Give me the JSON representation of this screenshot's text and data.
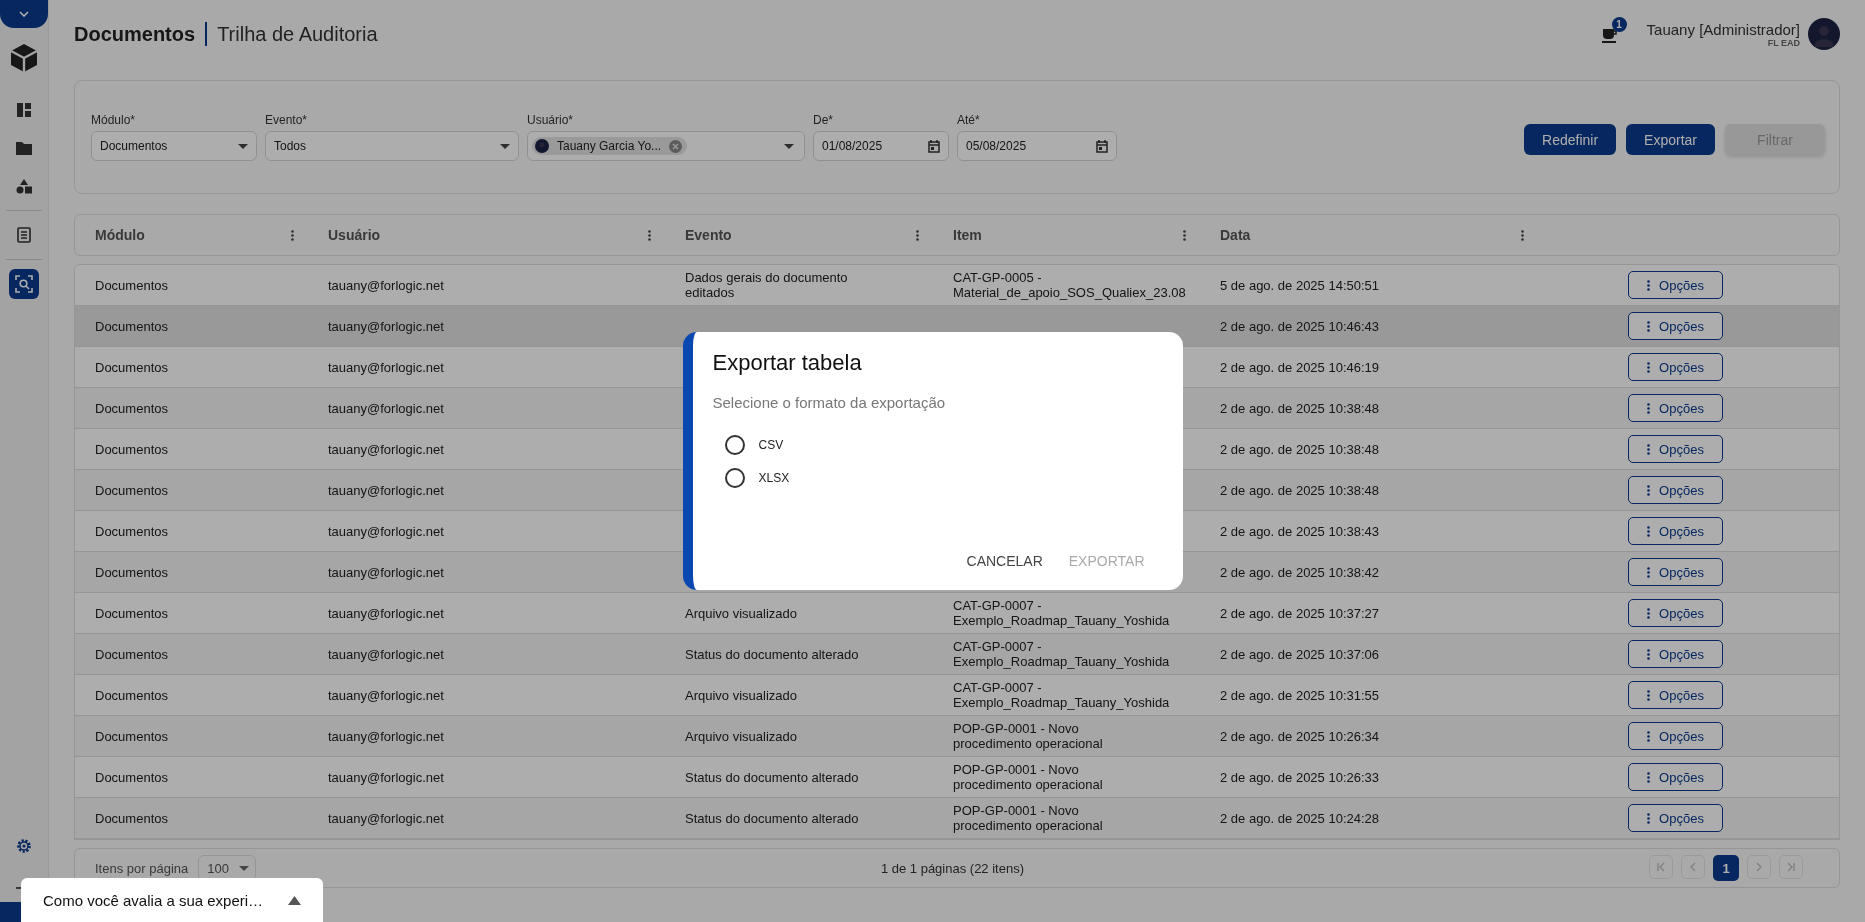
{
  "sidebar": {
    "items": [
      {
        "kind": "dashboard",
        "selected": false
      },
      {
        "kind": "folder",
        "selected": false
      },
      {
        "kind": "shapes",
        "selected": false
      },
      {
        "kind": "document",
        "selected": false
      },
      {
        "kind": "audit",
        "selected": true
      }
    ]
  },
  "header": {
    "module": "Documentos",
    "title": "Trilha de Auditoria",
    "notification_count": "1",
    "user_name": "Tauany [Administrador]",
    "user_org": "FL EAD"
  },
  "filters": {
    "fields": [
      {
        "kind": "select",
        "label": "Módulo*",
        "value": "Documentos"
      },
      {
        "kind": "select",
        "label": "Evento*",
        "value": "Todos"
      },
      {
        "kind": "chip",
        "label": "Usuário*",
        "value": "Tauany Garcia Yo..."
      },
      {
        "kind": "date",
        "label": "De*",
        "value": "01/08/2025"
      },
      {
        "kind": "date",
        "label": "Até*",
        "value": "05/08/2025"
      }
    ],
    "buttons": [
      {
        "label": "Redefinir",
        "disabled": false
      },
      {
        "label": "Exportar",
        "disabled": false
      },
      {
        "label": "Filtrar",
        "disabled": true
      }
    ]
  },
  "table": {
    "columns": [
      "Módulo",
      "Usuário",
      "Evento",
      "Item",
      "Data"
    ],
    "rows": [
      {
        "module": "Documentos",
        "user": "tauany@forlogic.net",
        "event": "Dados gerais do documento editados",
        "item": "CAT-GP-0005 - Material_de_apoio_SOS_Qualiex_23.08",
        "date": "5 de ago. de 2025 14:50:51",
        "action": "Opções",
        "highlighted": false
      },
      {
        "module": "Documentos",
        "user": "tauany@forlogic.net",
        "date": "2 de ago. de 2025 10:46:43",
        "action": "Opções",
        "highlighted": true
      },
      {
        "module": "Documentos",
        "user": "tauany@forlogic.net",
        "date": "2 de ago. de 2025 10:46:19",
        "action": "Opções",
        "highlighted": false
      },
      {
        "module": "Documentos",
        "user": "tauany@forlogic.net",
        "date": "2 de ago. de 2025 10:38:48",
        "action": "Opções",
        "highlighted": false
      },
      {
        "module": "Documentos",
        "user": "tauany@forlogic.net",
        "date": "2 de ago. de 2025 10:38:48",
        "action": "Opções",
        "highlighted": false
      },
      {
        "module": "Documentos",
        "user": "tauany@forlogic.net",
        "date": "2 de ago. de 2025 10:38:48",
        "action": "Opções",
        "highlighted": false
      },
      {
        "module": "Documentos",
        "user": "tauany@forlogic.net",
        "date": "2 de ago. de 2025 10:38:43",
        "action": "Opções",
        "highlighted": false
      },
      {
        "module": "Documentos",
        "user": "tauany@forlogic.net",
        "date": "2 de ago. de 2025 10:38:42",
        "action": "Opções",
        "highlighted": false
      },
      {
        "module": "Documentos",
        "user": "tauany@forlogic.net",
        "event": "Arquivo visualizado",
        "item": "CAT-GP-0007 - Exemplo_Roadmap_Tauany_Yoshida",
        "date": "2 de ago. de 2025 10:37:27",
        "action": "Opções",
        "highlighted": false
      },
      {
        "module": "Documentos",
        "user": "tauany@forlogic.net",
        "event": "Status do documento alterado",
        "item": "CAT-GP-0007 - Exemplo_Roadmap_Tauany_Yoshida",
        "date": "2 de ago. de 2025 10:37:06",
        "action": "Opções",
        "highlighted": false
      },
      {
        "module": "Documentos",
        "user": "tauany@forlogic.net",
        "event": "Arquivo visualizado",
        "item": "CAT-GP-0007 - Exemplo_Roadmap_Tauany_Yoshida",
        "date": "2 de ago. de 2025 10:31:55",
        "action": "Opções",
        "highlighted": false
      },
      {
        "module": "Documentos",
        "user": "tauany@forlogic.net",
        "event": "Arquivo visualizado",
        "item": "POP-GP-0001 - Novo procedimento operacional",
        "date": "2 de ago. de 2025 10:26:34",
        "action": "Opções",
        "highlighted": false
      },
      {
        "module": "Documentos",
        "user": "tauany@forlogic.net",
        "event": "Status do documento alterado",
        "item": "POP-GP-0001 - Novo procedimento operacional",
        "date": "2 de ago. de 2025 10:26:33",
        "action": "Opções",
        "highlighted": false
      },
      {
        "module": "Documentos",
        "user": "tauany@forlogic.net",
        "event": "Status do documento alterado",
        "item": "POP-GP-0001 - Novo procedimento operacional",
        "date": "2 de ago. de 2025 10:24:28",
        "action": "Opções",
        "highlighted": false
      }
    ]
  },
  "footer": {
    "per_page_label": "Itens por página",
    "per_page_value": "100",
    "page_info": "1 de 1 páginas (22 itens)",
    "pages": [
      {
        "label": "1",
        "selected": true
      }
    ]
  },
  "dialog": {
    "title": "Exportar tabela",
    "subtitle": "Selecione o formato da exportação",
    "options": [
      {
        "label": "CSV",
        "selected": false
      },
      {
        "label": "XLSX",
        "selected": false
      }
    ],
    "buttons": [
      {
        "label": "CANCELAR",
        "disabled": false
      },
      {
        "label": "EXPORTAR",
        "disabled": true
      }
    ]
  },
  "feedback": {
    "text": "Como você avalia a sua experi…"
  }
}
